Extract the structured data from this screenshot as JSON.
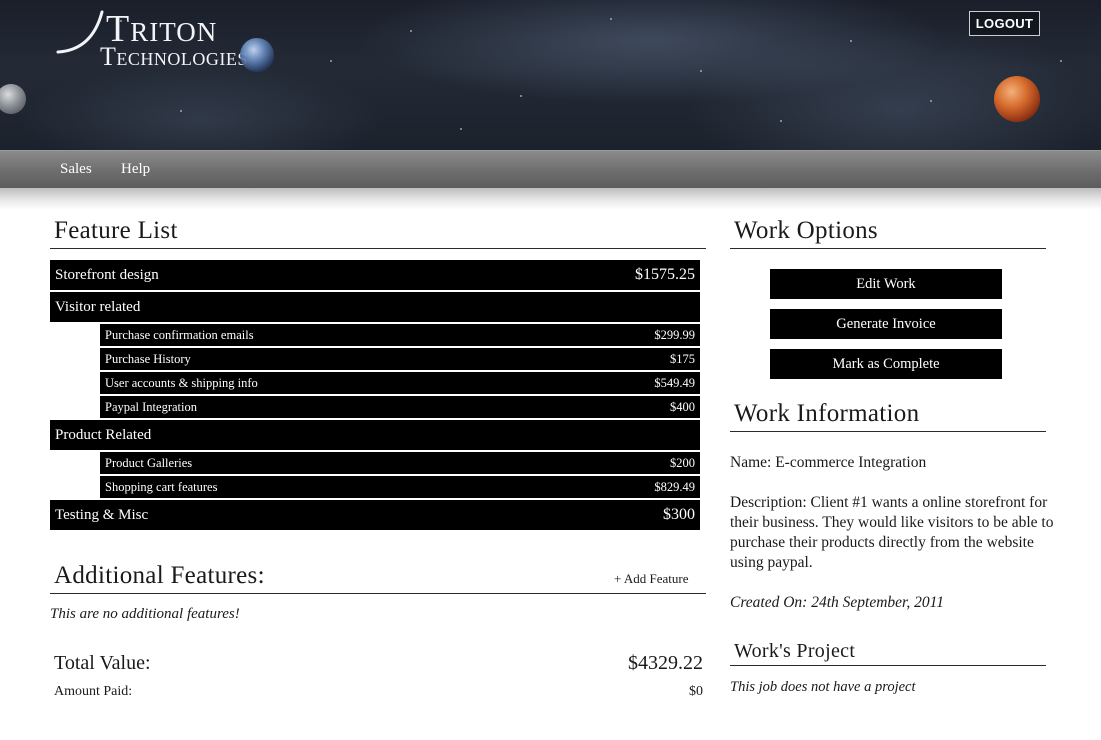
{
  "header": {
    "logo_line1": "Triton",
    "logo_line2": "Technologies",
    "logout_label": "LOGOUT"
  },
  "nav": {
    "items": [
      {
        "label": "Sales"
      },
      {
        "label": "Help"
      }
    ]
  },
  "feature_list": {
    "title": "Feature List",
    "rows": [
      {
        "kind": "main",
        "label": "Storefront design",
        "price": "$1575.25"
      },
      {
        "kind": "main",
        "label": "Visitor related",
        "price": ""
      },
      {
        "kind": "sub",
        "label": "Purchase confirmation emails",
        "price": "$299.99"
      },
      {
        "kind": "sub",
        "label": "Purchase History",
        "price": "$175"
      },
      {
        "kind": "sub",
        "label": "User accounts & shipping info",
        "price": "$549.49"
      },
      {
        "kind": "sub",
        "label": "Paypal Integration",
        "price": "$400"
      },
      {
        "kind": "main",
        "label": "Product Related",
        "price": ""
      },
      {
        "kind": "sub",
        "label": "Product Galleries",
        "price": "$200"
      },
      {
        "kind": "sub",
        "label": "Shopping cart features",
        "price": "$829.49"
      },
      {
        "kind": "main",
        "label": "Testing & Misc",
        "price": "$300"
      }
    ]
  },
  "additional_features": {
    "title": "Additional Features:",
    "add_label": "+ Add Feature",
    "empty_message": "This are no additional features!"
  },
  "totals": {
    "total_label": "Total Value:",
    "total_value": "$4329.22",
    "paid_label": "Amount Paid:",
    "paid_value": "$0"
  },
  "work_options": {
    "title": "Work Options",
    "buttons": [
      {
        "label": "Edit Work"
      },
      {
        "label": "Generate Invoice"
      },
      {
        "label": "Mark as Complete"
      }
    ]
  },
  "work_information": {
    "title": "Work Information",
    "name": "Name: E-commerce Integration",
    "description": "Description: Client #1 wants a online storefront for their business. They would like visitors to be able to purchase their products directly from the website using paypal.",
    "created_on": "Created On: 24th September, 2011"
  },
  "works_project": {
    "title": "Work's Project",
    "empty_message": "This job does not have a project"
  },
  "colors": {
    "row_background": "#000000",
    "row_text": "#ffffff",
    "nav_background": "#6d6d6d"
  }
}
